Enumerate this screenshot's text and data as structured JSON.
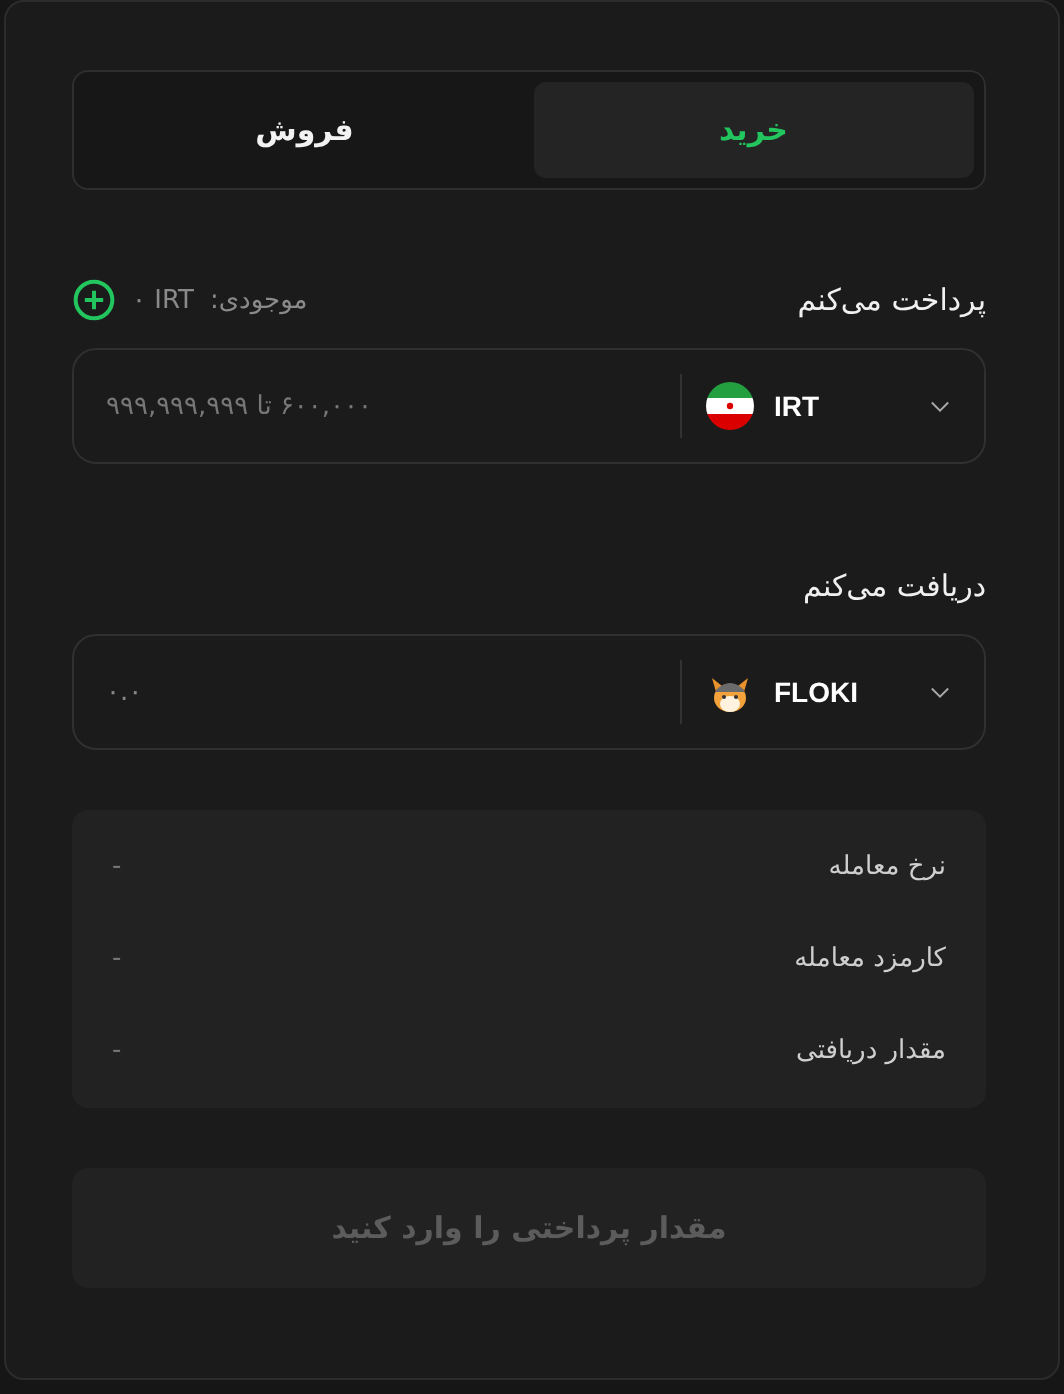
{
  "tabs": [
    {
      "label": "خرید",
      "selected": true
    },
    {
      "label": "فروش",
      "selected": false
    }
  ],
  "pay": {
    "label": "پرداخت می‌کنم",
    "balance_label": "موجودی:",
    "balance_value": "۰ IRT",
    "amount": {
      "placeholder": "۶۰۰,۰۰۰ تا ۹۹۹,۹۹۹,۹۹۹"
    },
    "currency": {
      "code": "IRT",
      "kind": "flag"
    }
  },
  "receive": {
    "label": "دریافت می‌کنم",
    "amount": {
      "value": "۰.۰"
    },
    "currency": {
      "code": "FLOKI",
      "kind": "token"
    }
  },
  "summary": [
    {
      "label": "نرخ معامله",
      "value": "-"
    },
    {
      "label": "کارمزد معامله",
      "value": "-"
    },
    {
      "label": "مقدار دریافتی",
      "value": "-"
    }
  ],
  "submit": {
    "label": "مقدار پرداختی را وارد کنید",
    "disabled": true
  }
}
